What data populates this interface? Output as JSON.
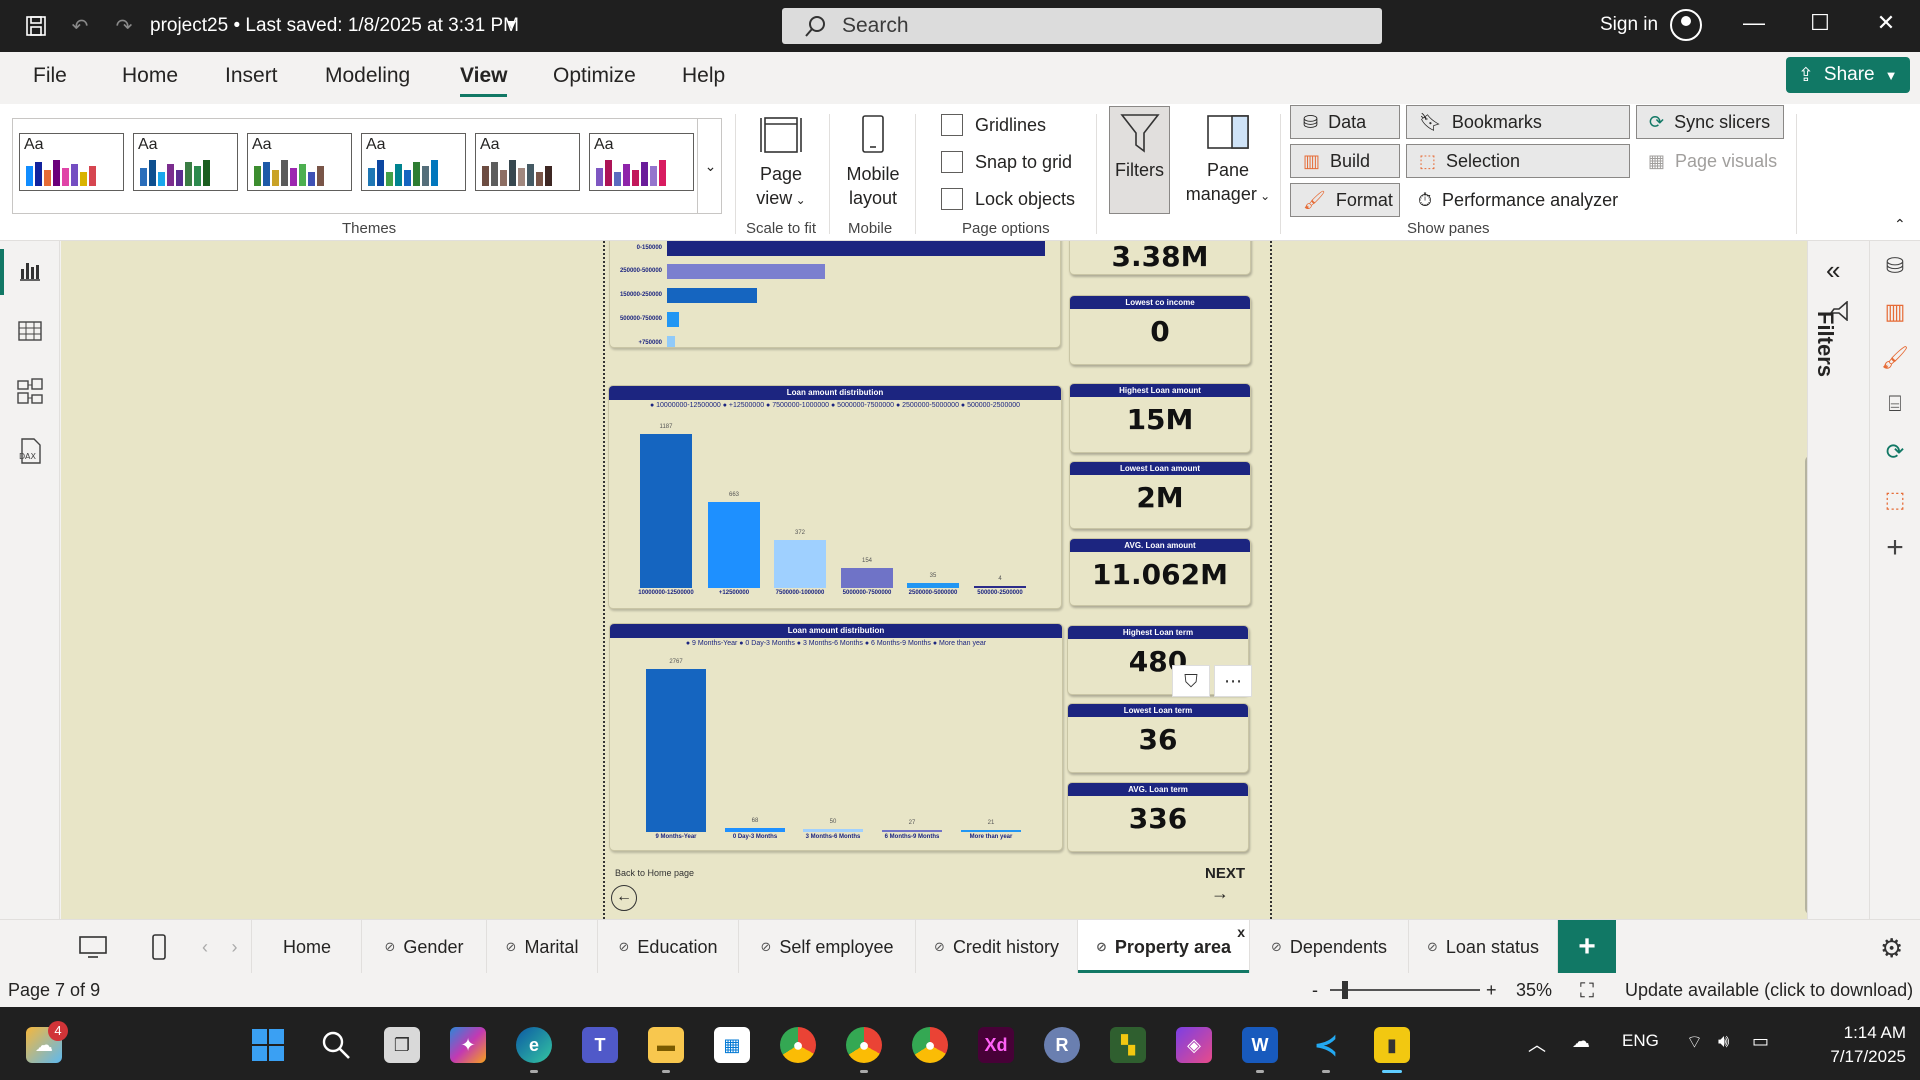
{
  "titlebar": {
    "project_title": "project25 • Last saved: 1/8/2025 at 3:31 PM",
    "search_placeholder": "Search",
    "sign_in": "Sign in"
  },
  "menu": {
    "items": [
      "File",
      "Home",
      "Insert",
      "Modeling",
      "View",
      "Optimize",
      "Help"
    ],
    "active": "View",
    "share": "Share"
  },
  "ribbon": {
    "themes_label": "Themes",
    "theme_tile_text": "Aa",
    "page_view_line1": "Page",
    "page_view_line2": "view",
    "scale_to_fit": "Scale to fit",
    "mobile_layout_line1": "Mobile",
    "mobile_layout_line2": "layout",
    "mobile_label": "Mobile",
    "gridlines": "Gridlines",
    "snap_to_grid": "Snap to grid",
    "lock_objects": "Lock objects",
    "page_options_label": "Page options",
    "filters": "Filters",
    "pane_manager_line1": "Pane",
    "pane_manager_line2": "manager",
    "data": "Data",
    "bookmarks": "Bookmarks",
    "sync_slicers": "Sync slicers",
    "build": "Build",
    "selection": "Selection",
    "page_visuals": "Page visuals",
    "format": "Format",
    "performance_analyzer": "Performance analyzer",
    "show_panes_label": "Show panes"
  },
  "report": {
    "income_bars": {
      "categories": [
        "0-150000",
        "250000-500000",
        "150000-250000",
        "500000-750000",
        "+750000"
      ],
      "colors": [
        "#1c2580",
        "#7b7fcf",
        "#1565c0",
        "#2196f3",
        "#90caf9"
      ]
    },
    "loan_amount_chart": {
      "title": "Loan amount distribution",
      "legend": "● 10000000-12500000  ● +12500000  ● 7500000-1000000  ● 5000000-7500000  ● 2500000-5000000  ● 500000-2500000",
      "categories": [
        "10000000-12500000",
        "+12500000",
        "7500000-1000000",
        "5000000-7500000",
        "2500000-5000000",
        "500000-2500000"
      ],
      "values": [
        "1187",
        "663",
        "372",
        "154",
        "35",
        "4"
      ],
      "colors": [
        "#1565c0",
        "#1e90ff",
        "#9fd0ff",
        "#6f73c7",
        "#2196f3",
        "#2c2c8a"
      ]
    },
    "loan_term_chart": {
      "title": "Loan amount distribution",
      "legend": "● 9 Months-Year  ● 0 Day-3 Months  ● 3 Months-6 Months  ● 6 Months-9 Months  ● More than year",
      "categories": [
        "9 Months-Year",
        "0 Day-3 Months",
        "3 Months-6 Months",
        "6 Months-9 Months",
        "More than year"
      ],
      "values": [
        "2767",
        "68",
        "50",
        "27",
        "21"
      ],
      "colors": [
        "#1565c0",
        "#1e90ff",
        "#9fd0ff",
        "#6f73c7",
        "#2196f3"
      ]
    },
    "kpis": [
      {
        "title": "",
        "value": "3.38M"
      },
      {
        "title": "Lowest co income",
        "value": "0"
      },
      {
        "title": "Highest Loan amount",
        "value": "15M"
      },
      {
        "title": "Lowest Loan amount",
        "value": "2M"
      },
      {
        "title": "AVG. Loan amount",
        "value": "11.062M"
      },
      {
        "title": "Highest Loan term",
        "value": "480"
      },
      {
        "title": "Lowest Loan term",
        "value": "36"
      },
      {
        "title": "AVG. Loan term",
        "value": "336"
      }
    ],
    "back_home": "Back to Home page",
    "next": "NEXT"
  },
  "filters_pane": {
    "label": "Filters"
  },
  "tabs": {
    "items": [
      "Home",
      "Gender",
      "Marital",
      "Education",
      "Self employee",
      "Credit history",
      "Property area",
      "Dependents",
      "Loan status"
    ],
    "active": "Property area",
    "close": "x",
    "add": "+"
  },
  "status": {
    "page": "Page 7 of 9",
    "zoom_minus": "-",
    "zoom_plus": "+",
    "zoom": "35%",
    "update": "Update available (click to download)"
  },
  "taskbar": {
    "notification_count": "4",
    "lang": "ENG",
    "time": "1:14 AM",
    "date": "7/17/2025"
  },
  "colors": {
    "accent": "#117865",
    "canvas": "#e8e5c7",
    "chart_header": "#1c2580"
  }
}
